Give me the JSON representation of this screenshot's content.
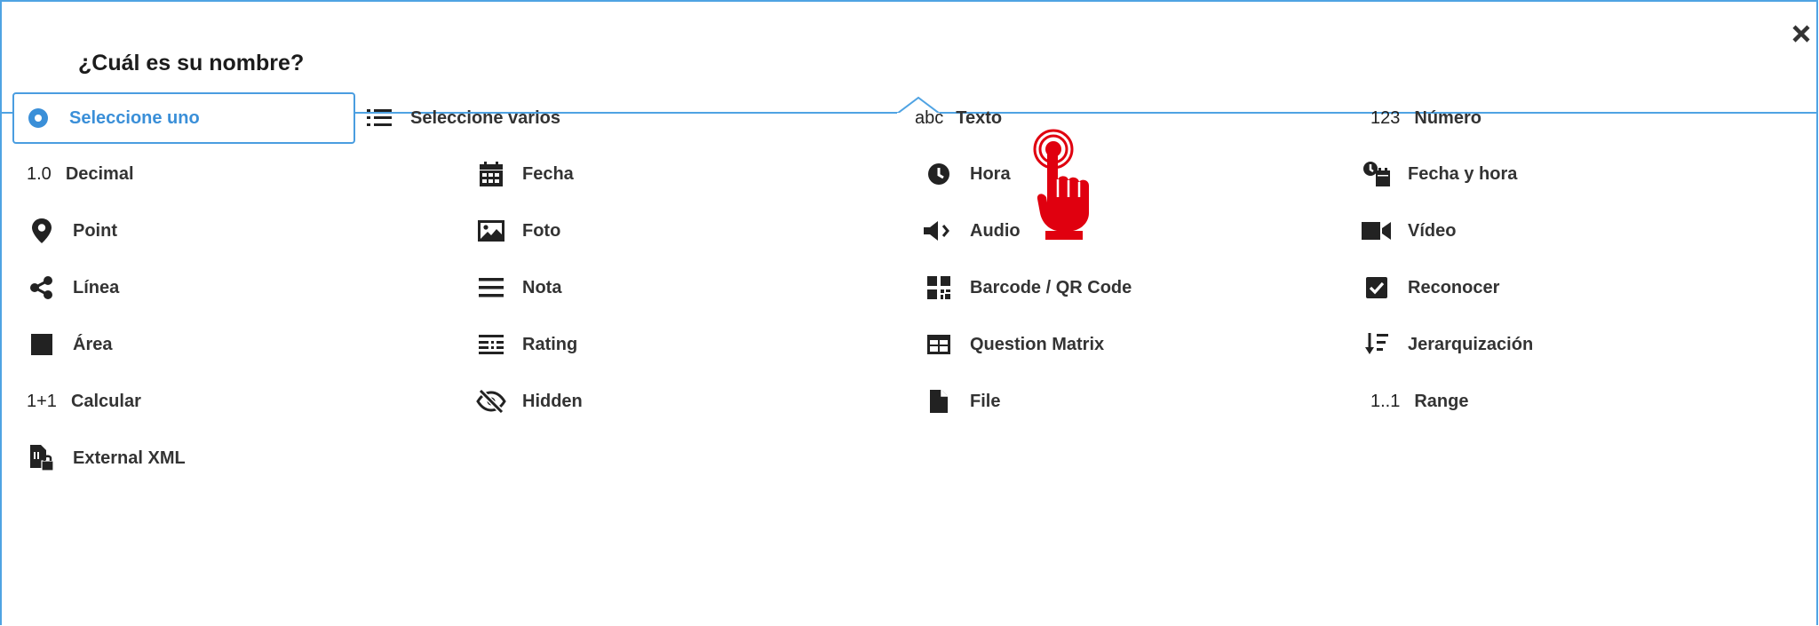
{
  "dialog": {
    "title": "¿Cuál es su nombre?",
    "accent_color": "#4fa3e3",
    "close_icon": "close-icon"
  },
  "types": [
    {
      "label": "Seleccione uno",
      "icon": "radio-icon",
      "selected": true
    },
    {
      "label": "Seleccione varios",
      "icon": "list-icon"
    },
    {
      "label": "Texto",
      "icon_text": "abc"
    },
    {
      "label": "Número",
      "icon_text": "123"
    },
    {
      "label": "Decimal",
      "icon_text": "1.0"
    },
    {
      "label": "Fecha",
      "icon": "calendar-icon"
    },
    {
      "label": "Hora",
      "icon": "clock-icon"
    },
    {
      "label": "Fecha y hora",
      "icon": "datetime-icon"
    },
    {
      "label": "Point",
      "icon": "map-pin-icon"
    },
    {
      "label": "Foto",
      "icon": "image-icon"
    },
    {
      "label": "Audio",
      "icon": "speaker-icon"
    },
    {
      "label": "Vídeo",
      "icon": "video-icon"
    },
    {
      "label": "Línea",
      "icon": "share-icon"
    },
    {
      "label": "Nota",
      "icon": "menu-icon"
    },
    {
      "label": "Barcode / QR Code",
      "icon": "qr-code-icon"
    },
    {
      "label": "Reconocer",
      "icon": "checkbox-icon"
    },
    {
      "label": "Área",
      "icon": "square-icon"
    },
    {
      "label": "Rating",
      "icon": "rating-icon"
    },
    {
      "label": "Question Matrix",
      "icon": "table-icon"
    },
    {
      "label": "Jerarquización",
      "icon": "sort-icon"
    },
    {
      "label": "Calcular",
      "icon_text": "1+1"
    },
    {
      "label": "Hidden",
      "icon": "eye-slash-icon"
    },
    {
      "label": "File",
      "icon": "file-icon"
    },
    {
      "label": "Range",
      "icon_text": "1..1"
    },
    {
      "label": "External XML",
      "icon": "file-lock-icon"
    }
  ],
  "pointer": {
    "icon": "hand-pointer-icon",
    "color": "#e0000f"
  }
}
